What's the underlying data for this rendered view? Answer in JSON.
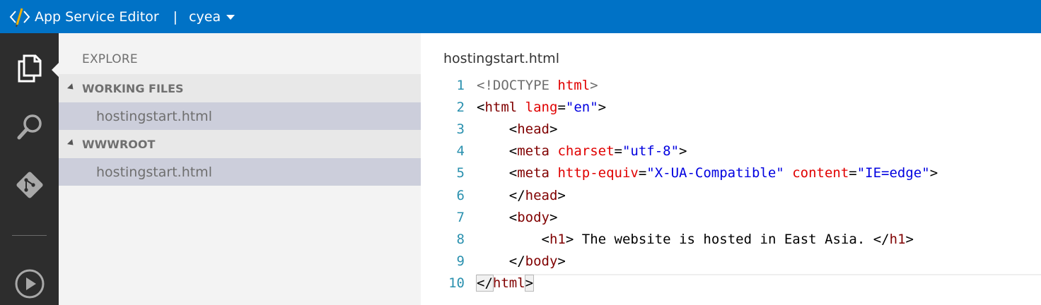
{
  "topbar": {
    "app_title": "App Service Editor",
    "separator": "|",
    "site_name": "cyea",
    "logo_icon": "code-pencil-logo",
    "background": "#0072c6"
  },
  "activity_bar": {
    "items": [
      {
        "name": "explore",
        "icon": "files-icon"
      },
      {
        "name": "search",
        "icon": "search-icon"
      },
      {
        "name": "git",
        "icon": "git-icon"
      },
      {
        "name": "run",
        "icon": "play-circle-icon"
      }
    ]
  },
  "sidebar": {
    "title": "EXPLORE",
    "sections": [
      {
        "label": "WORKING FILES",
        "files": [
          "hostingstart.html"
        ]
      },
      {
        "label": "WWWROOT",
        "files": [
          "hostingstart.html"
        ]
      }
    ]
  },
  "editor": {
    "tab_title": "hostingstart.html",
    "line_numbers": [
      "1",
      "2",
      "3",
      "4",
      "5",
      "6",
      "7",
      "8",
      "9",
      "10"
    ],
    "code_lines": [
      "<!DOCTYPE html>",
      "<html lang=\"en\">",
      "    <head>",
      "    <meta charset=\"utf-8\">",
      "    <meta http-equiv=\"X-UA-Compatible\" content=\"IE=edge\">",
      "    </head>",
      "    <body>",
      "        <h1> The website is hosted in East Asia. </h1>",
      "    </body>",
      "</html>"
    ]
  }
}
